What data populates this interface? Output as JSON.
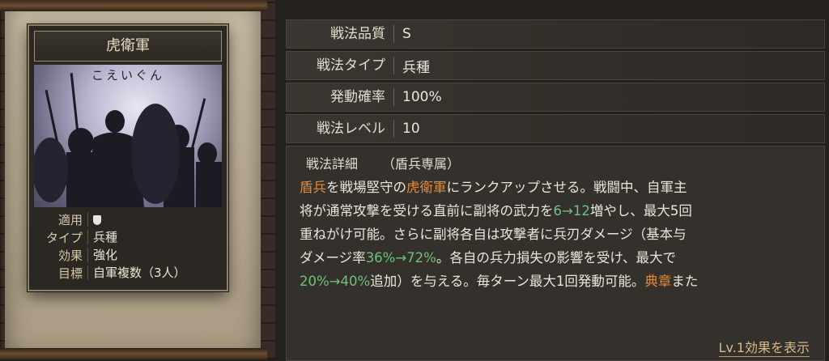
{
  "card": {
    "title": "虎衛軍",
    "reading": "こえいぐん",
    "info": [
      {
        "label": "適用",
        "value": "",
        "icon": "shield-icon"
      },
      {
        "label": "タイプ",
        "value": "兵種"
      },
      {
        "label": "効果",
        "value": "強化"
      },
      {
        "label": "目標",
        "value": "自軍複数（3人）"
      }
    ]
  },
  "stats": [
    {
      "label": "戦法品質",
      "value": "S"
    },
    {
      "label": "戦法タイプ",
      "value": "兵種"
    },
    {
      "label": "発動確率",
      "value": "100%"
    },
    {
      "label": "戦法レベル",
      "value": "10"
    }
  ],
  "detail": {
    "label": "戦法詳細",
    "tag": "（盾兵専属）",
    "lines": [
      [
        "盾兵",
        "を戦場堅守の",
        "虎衛軍",
        "にランクアップさせる。戦闘中、自軍主"
      ],
      [
        "将が通常攻撃を受ける直前に副将の武力を",
        "6→12",
        "増やし、最大5回"
      ],
      [
        "重ねがけ可能。さらに副将各自は攻撃者に兵刃ダメージ（基本与"
      ],
      [
        "ダメージ率",
        "36%→72%",
        "。各自の兵力損失の影響を受け、最大で"
      ],
      [
        "20%→40%",
        "追加）を与える。毎ターン最大1回発動可能。",
        "典章",
        "また"
      ]
    ],
    "link": "Lv.1効果を表示"
  },
  "colors": {
    "highlight_orange": "#e08a3c",
    "highlight_green": "#6fc27b"
  }
}
